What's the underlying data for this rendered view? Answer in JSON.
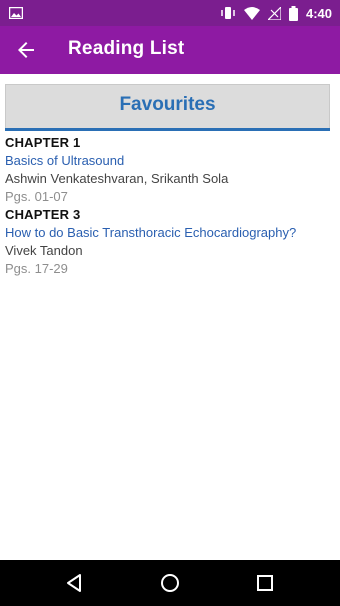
{
  "status_bar": {
    "time": "4:40",
    "icons": [
      "image-icon",
      "vibrate-icon",
      "wifi-icon",
      "no-signal-icon",
      "battery-icon"
    ]
  },
  "app_bar": {
    "title": "Reading List",
    "back_icon": "arrow-left-icon"
  },
  "tab": {
    "label": "Favourites"
  },
  "items": [
    {
      "chapter": "CHAPTER 1",
      "title": "Basics of Ultrasound",
      "authors": "Ashwin Venkateshvaran, Srikanth Sola",
      "pages": "Pgs. 01-07"
    },
    {
      "chapter": "CHAPTER 3",
      "title": "How to do Basic Transthoracic Echocardiography?",
      "authors": "Vivek Tandon",
      "pages": "Pgs. 17-29"
    }
  ],
  "nav_bar": {
    "icons": [
      "back-icon",
      "home-icon",
      "recents-icon"
    ]
  },
  "colors": {
    "status_bar": "#7b1e8f",
    "app_bar": "#8e1aa3",
    "accent_blue": "#2a6fb5",
    "tab_bg": "#dcdcdc"
  }
}
